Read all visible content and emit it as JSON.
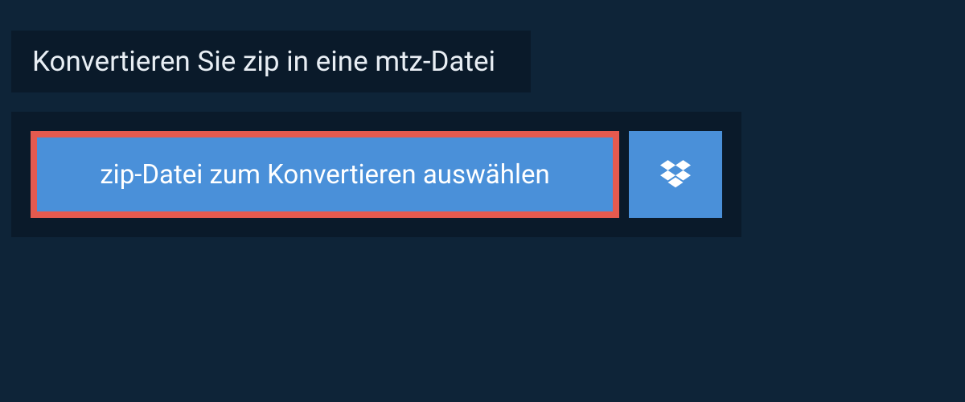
{
  "header": {
    "title": "Konvertieren Sie zip in eine mtz-Datei"
  },
  "upload": {
    "selectLabel": "zip-Datei zum Konvertieren auswählen",
    "dropboxIcon": "dropbox"
  },
  "colors": {
    "pageBg": "#0e2438",
    "panelBg": "#0a1a2a",
    "buttonBg": "#4a90d9",
    "highlightBorder": "#e55a4f",
    "text": "#ffffff"
  }
}
